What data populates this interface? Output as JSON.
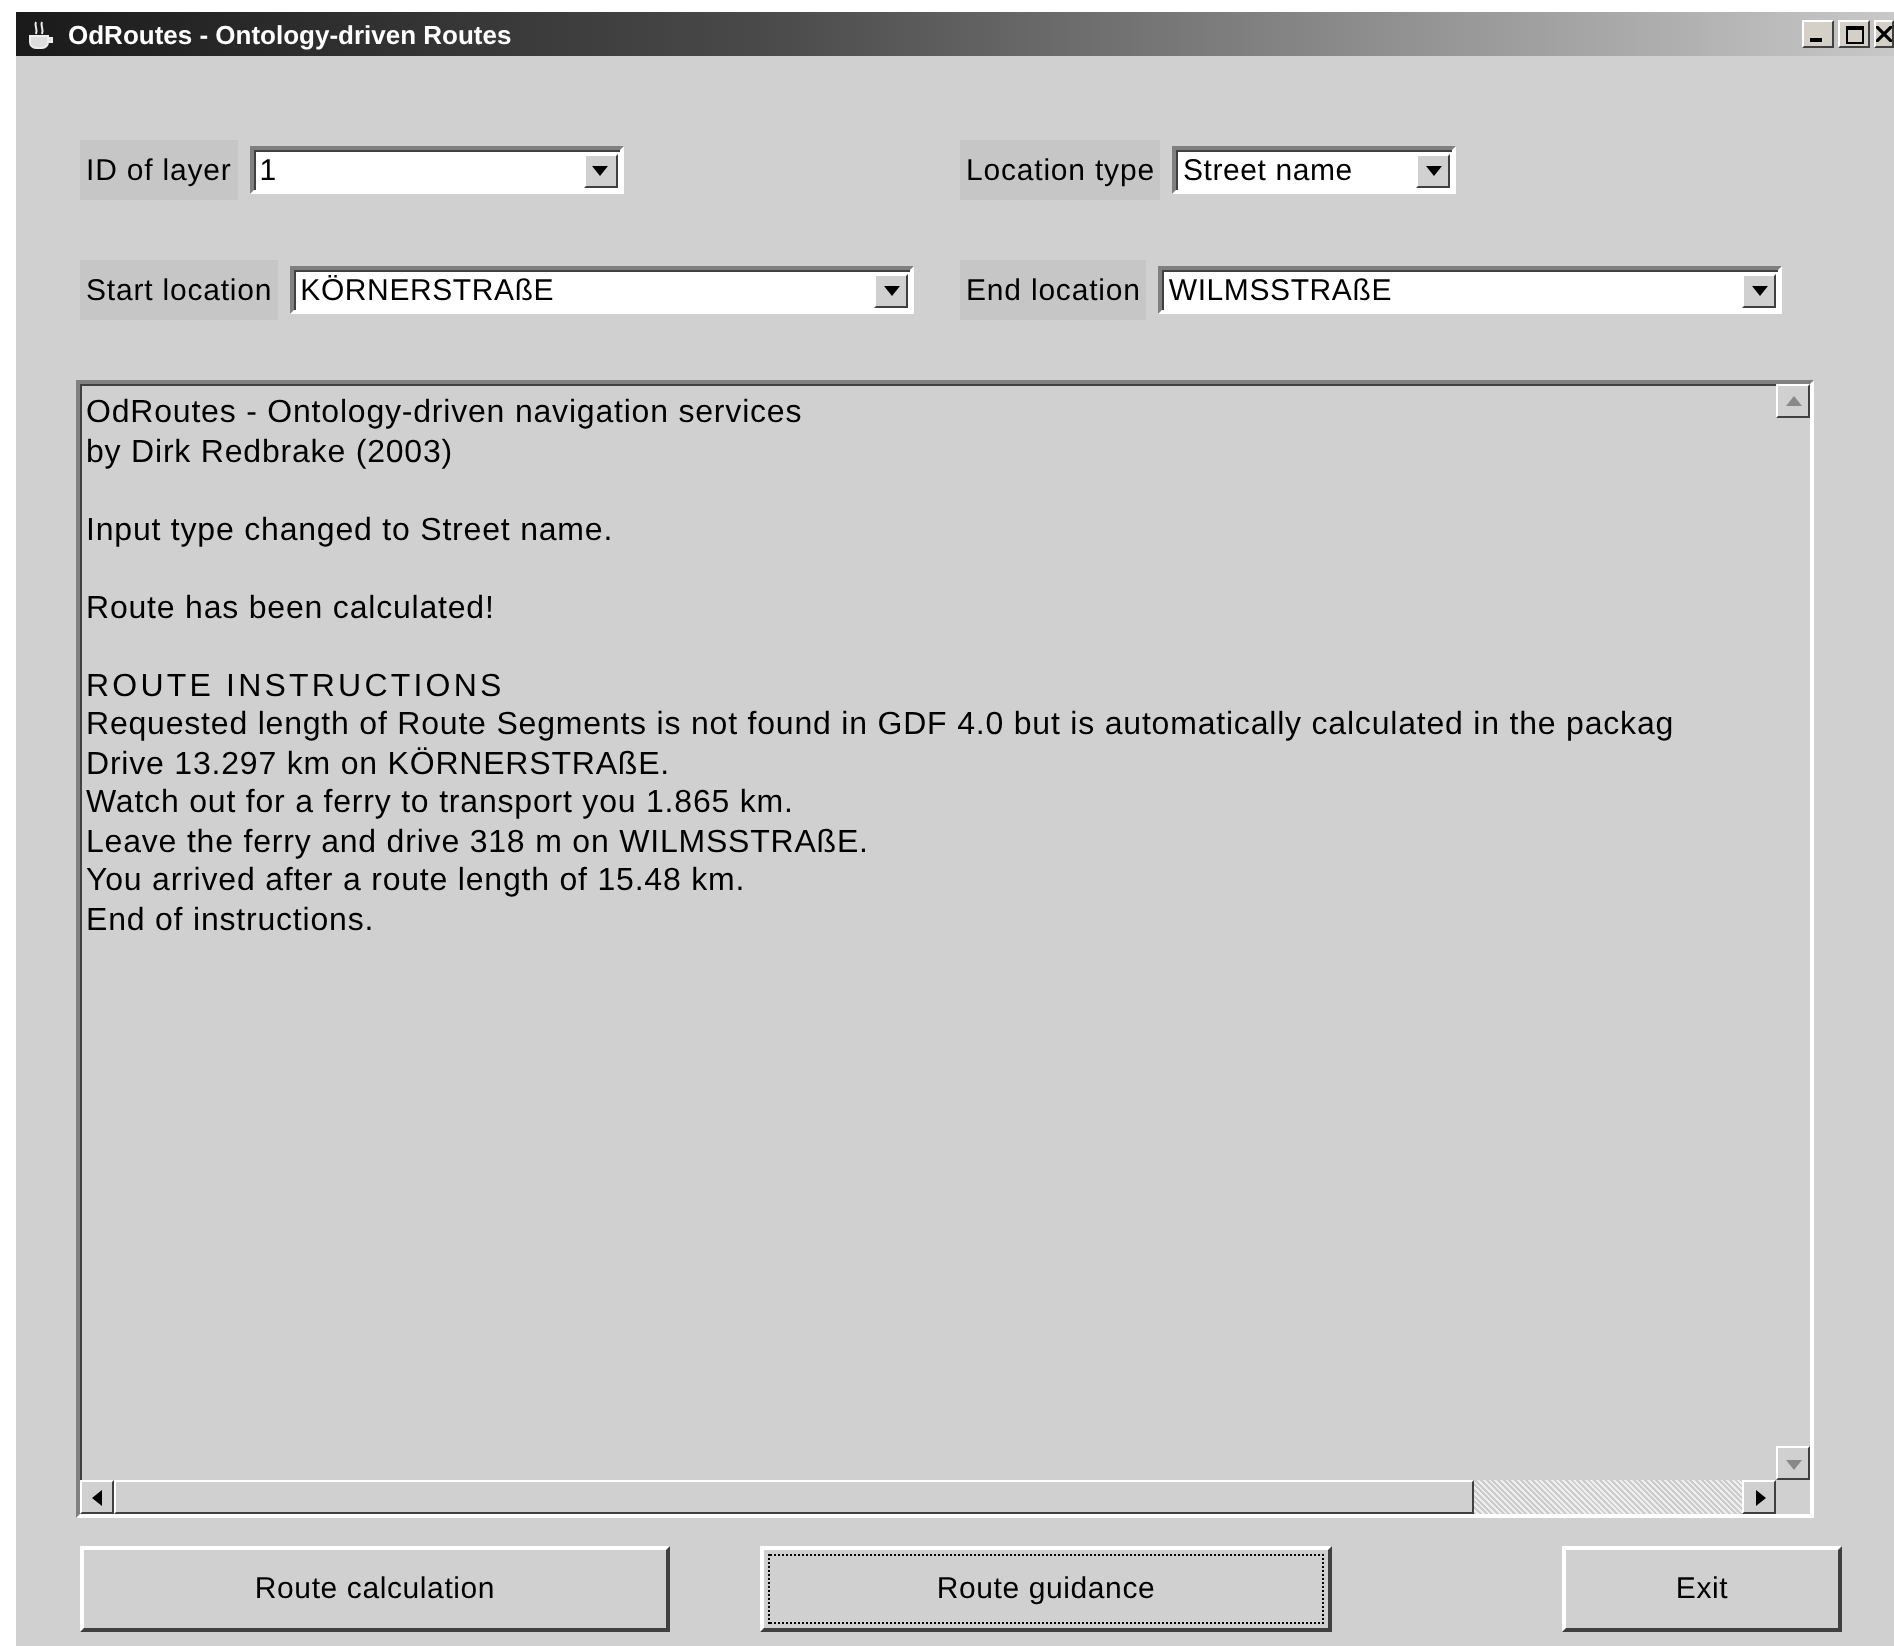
{
  "window": {
    "title": "OdRoutes - Ontology-driven Routes"
  },
  "fields": [
    {
      "label": "ID of layer",
      "value": "1"
    },
    {
      "label": "Location type",
      "value": "Street name"
    },
    {
      "label": "Start location",
      "value": "KÖRNERSTRAßE"
    },
    {
      "label": "End location",
      "value": "WILMSSTRAßE"
    }
  ],
  "log": [
    {
      "lines": [
        "OdRoutes - Ontology-driven navigation services",
        "by Dirk Redbrake (2003)"
      ]
    },
    {
      "lines": [
        "Input type changed to Street name."
      ]
    },
    {
      "lines": [
        "Route has been calculated!"
      ]
    },
    {
      "heading": "ROUTE INSTRUCTIONS",
      "lines": [
        "Requested length of Route Segments is not found in GDF 4.0 but is automatically calculated in the packag",
        "Drive 13.297 km on KÖRNERSTRAßE.",
        "Watch out for a ferry to transport you 1.865 km.",
        "Leave the ferry and drive 318 m on WILMSSTRAßE.",
        "You arrived after a route length of 15.48 km.",
        "End of instructions."
      ]
    }
  ],
  "buttons": [
    {
      "label": "Route calculation",
      "focused": false
    },
    {
      "label": "Route guidance",
      "focused": true
    },
    {
      "label": "Exit",
      "focused": false
    }
  ]
}
